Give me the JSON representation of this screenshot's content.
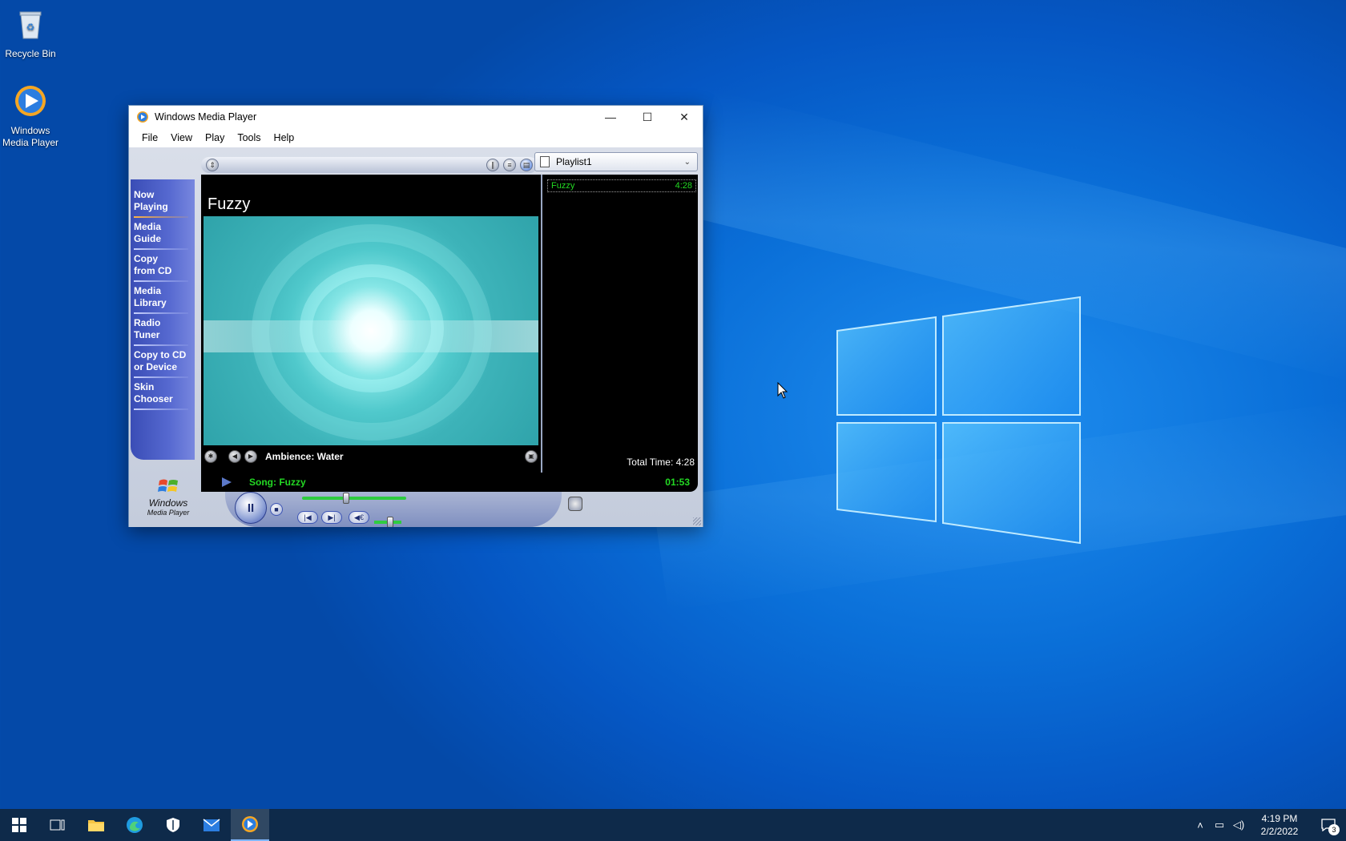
{
  "desktop": {
    "icons": [
      {
        "label": "Recycle Bin",
        "icon": "recycle-bin-icon"
      },
      {
        "label": "Windows Media Player",
        "icon": "media-player-icon"
      }
    ]
  },
  "window": {
    "title": "Windows Media Player",
    "menu": [
      "File",
      "View",
      "Play",
      "Tools",
      "Help"
    ],
    "controls": {
      "minimize": "—",
      "maximize": "☐",
      "close": "✕"
    }
  },
  "taskpane": {
    "items": [
      {
        "line1": "Now",
        "line2": "Playing"
      },
      {
        "line1": "Media",
        "line2": "Guide"
      },
      {
        "line1": "Copy",
        "line2": "from CD"
      },
      {
        "line1": "Media",
        "line2": "Library"
      },
      {
        "line1": "Radio",
        "line2": "Tuner"
      },
      {
        "line1": "Copy to CD",
        "line2": "or Device"
      },
      {
        "line1": "Skin",
        "line2": "Chooser"
      }
    ],
    "logo_line1": "Windows",
    "logo_line2": "Media Player"
  },
  "now_playing": {
    "clip_title": "Fuzzy",
    "visualization": "Ambience: Water"
  },
  "playlist": {
    "name": "Playlist1",
    "items": [
      {
        "title": "Fuzzy",
        "duration": "4:28"
      }
    ],
    "total": "Total Time: 4:28"
  },
  "status": {
    "song": "Song: Fuzzy",
    "time": "01:53"
  },
  "transport": {
    "pause": "II",
    "stop": "■",
    "prev": "|◀",
    "next": "▶|",
    "mute": "◀€",
    "seek_fraction": 0.42,
    "volume_fraction": 0.6
  },
  "taskbar": {
    "clock_time": "4:19 PM",
    "clock_date": "2/2/2022",
    "notification_count": "3"
  },
  "colors": {
    "green_text": "#23d923",
    "skin_blue": "#3a4db6"
  }
}
